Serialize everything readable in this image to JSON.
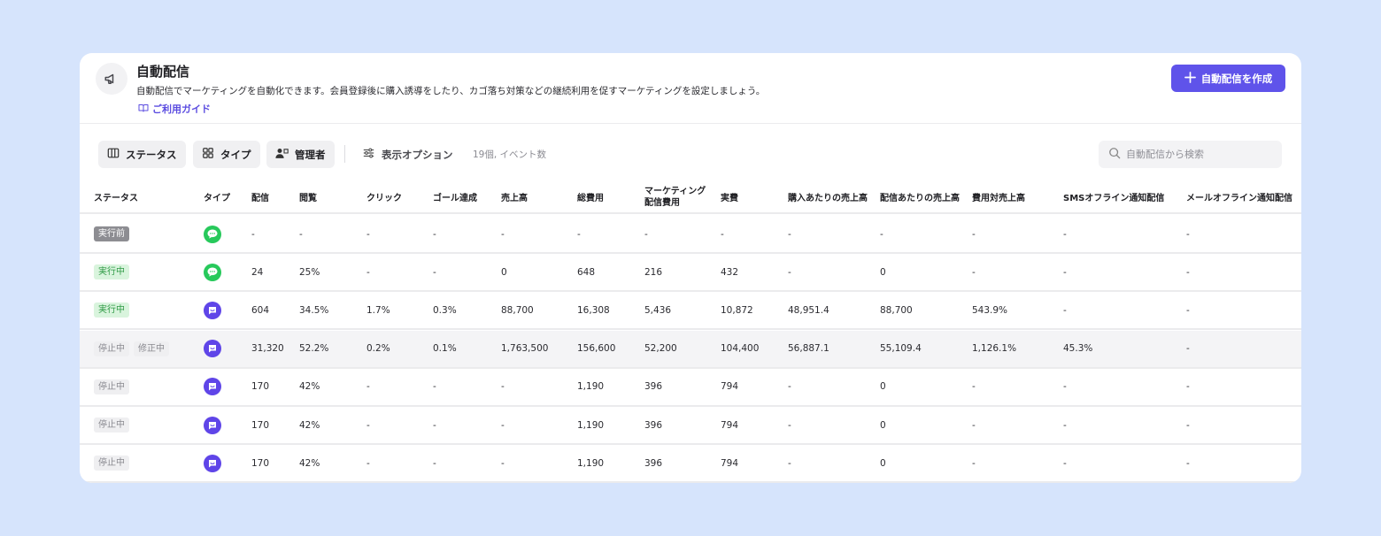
{
  "header": {
    "title": "自動配信",
    "description": "自動配信でマーケティングを自動化できます。会員登録後に購入誘導をしたり、カゴ落ち対策などの継続利用を促すマーケティングを設定しましょう。",
    "guide_label": "ご利用ガイド",
    "create_button": "自動配信を作成",
    "icon": "megaphone-icon"
  },
  "toolbar": {
    "chips": [
      {
        "label": "ステータス",
        "icon": "columns-icon"
      },
      {
        "label": "タイプ",
        "icon": "grid-icon"
      },
      {
        "label": "管理者",
        "icon": "person-icon"
      }
    ],
    "options_label": "表示オプション",
    "count_text": "19個, イベント数",
    "search_placeholder": "自動配信から検索"
  },
  "columns": [
    "ステータス",
    "タイプ",
    "配信",
    "閲覧",
    "クリック",
    "ゴール達成",
    "売上高",
    "総費用",
    "マーケティング",
    "配信費用",
    "実費",
    "購入あたりの売上高",
    "配信あたりの売上高",
    "費用対売上高",
    "SMSオフライン通知配信",
    "メールオフライン通知配信"
  ],
  "rows": [
    {
      "status": [
        "実行前"
      ],
      "type": "line",
      "cells": [
        "-",
        "-",
        "-",
        "-",
        "-",
        "-",
        "-",
        "-",
        "-",
        "-",
        "-",
        "-",
        "-"
      ]
    },
    {
      "status": [
        "実行中"
      ],
      "type": "line",
      "cells": [
        "24",
        "25%",
        "-",
        "-",
        "0",
        "648",
        "216",
        "432",
        "-",
        "0",
        "-",
        "-",
        "-"
      ]
    },
    {
      "status": [
        "実行中"
      ],
      "type": "app",
      "cells": [
        "604",
        "34.5%",
        "1.7%",
        "0.3%",
        "88,700",
        "16,308",
        "5,436",
        "10,872",
        "48,951.4",
        "88,700",
        "543.9%",
        "-",
        "-"
      ]
    },
    {
      "status": [
        "停止中",
        "修正中"
      ],
      "type": "app",
      "cells": [
        "31,320",
        "52.2%",
        "0.2%",
        "0.1%",
        "1,763,500",
        "156,600",
        "52,200",
        "104,400",
        "56,887.1",
        "55,109.4",
        "1,126.1%",
        "45.3%",
        "-"
      ]
    },
    {
      "status": [
        "停止中"
      ],
      "type": "app",
      "cells": [
        "170",
        "42%",
        "-",
        "-",
        "-",
        "1,190",
        "396",
        "794",
        "-",
        "0",
        "-",
        "-",
        "-"
      ]
    },
    {
      "status": [
        "停止中"
      ],
      "type": "app",
      "cells": [
        "170",
        "42%",
        "-",
        "-",
        "-",
        "1,190",
        "396",
        "794",
        "-",
        "0",
        "-",
        "-",
        "-"
      ]
    },
    {
      "status": [
        "停止中"
      ],
      "type": "app",
      "cells": [
        "170",
        "42%",
        "-",
        "-",
        "-",
        "1,190",
        "396",
        "794",
        "-",
        "0",
        "-",
        "-",
        "-"
      ]
    }
  ],
  "colors": {
    "accent": "#5f53ea",
    "page_bg": "#d6e4fc",
    "running_bg": "#d9f4dd",
    "running_text": "#2f9a45",
    "line_icon": "#27c95b",
    "app_icon": "#5f45e8"
  }
}
